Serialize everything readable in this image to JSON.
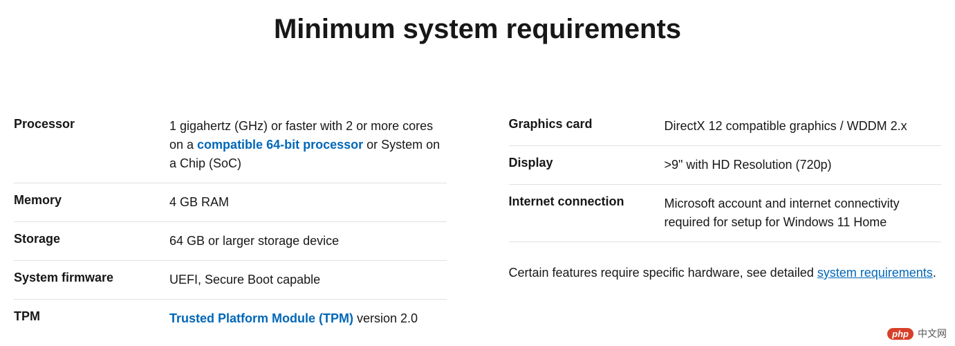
{
  "title": "Minimum system requirements",
  "left_rows": [
    {
      "label": "Processor",
      "value_pre": "1 gigahertz (GHz) or faster with 2 or more cores on a ",
      "link": "compatible 64-bit processor",
      "value_post": " or System on a Chip (SoC)"
    },
    {
      "label": "Memory",
      "value": "4 GB RAM"
    },
    {
      "label": "Storage",
      "value": "64 GB or larger storage device"
    },
    {
      "label": "System firmware",
      "value": "UEFI, Secure Boot capable"
    },
    {
      "label": "TPM",
      "link": "Trusted Platform Module (TPM)",
      "value_post": " version 2.0"
    }
  ],
  "right_rows": [
    {
      "label": "Graphics card",
      "value": "DirectX 12 compatible graphics / WDDM 2.x"
    },
    {
      "label": "Display",
      "value": ">9\" with HD Resolution (720p)"
    },
    {
      "label": "Internet connection",
      "value": "Microsoft account and internet connectivity required for setup for Windows 11 Home"
    }
  ],
  "note": {
    "pre": "Certain features require specific hardware, see detailed ",
    "link": "system requirements",
    "post": "."
  },
  "watermark": {
    "badge": "php",
    "text": "中文网"
  }
}
